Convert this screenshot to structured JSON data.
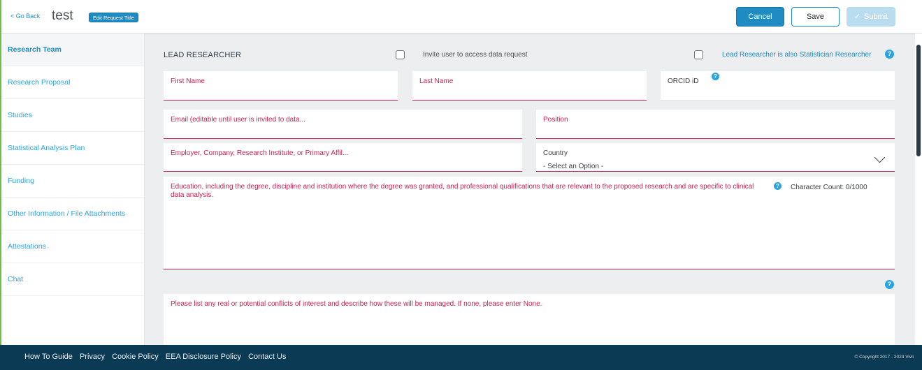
{
  "header": {
    "go_back": "< Go Back",
    "title": "test",
    "edit_title_label": "Edit Request Title",
    "cancel_label": "Cancel",
    "save_label": "Save",
    "submit_label": "Submit"
  },
  "sidebar": {
    "items": [
      {
        "label": "Research Team"
      },
      {
        "label": "Research Proposal"
      },
      {
        "label": "Studies"
      },
      {
        "label": "Statistical Analysis Plan"
      },
      {
        "label": "Funding"
      },
      {
        "label": "Other Information / File Attachments"
      },
      {
        "label": "Attestations"
      },
      {
        "label": "Chat"
      }
    ]
  },
  "main": {
    "section_title": "LEAD RESEARCHER",
    "invite_label": "Invite user to access data request",
    "statistician_label": "Lead Researcher is also Statistician Researcher",
    "help_glyph": "?",
    "fields": {
      "first_name": "First Name",
      "last_name": "Last Name",
      "orcid": "ORCID iD",
      "email": "Email (editable until user is invited to data...",
      "position": "Position",
      "employer": "Employer, Company, Research Institute, or Primary Affil...",
      "country": "Country",
      "country_value": "- Select an Option -",
      "education": "Education, including the degree, discipline and institution where the degree was granted, and professional qualifications that are relevant to the proposed research and are specific to clinical data analysis.",
      "character_count": "Character Count:  0/1000",
      "conflicts": "Please list any real or potential conflicts of interest and describe how these will be managed. If none, please enter None."
    }
  },
  "footer": {
    "links": [
      "How To Guide",
      "Privacy",
      "Cookie Policy",
      "EEA Disclosure Policy",
      "Contact Us"
    ],
    "copyright": "© Copyright 2017 - 2023 Vivli"
  },
  "colors": {
    "accent_blue": "#1e8bc3",
    "required_red": "#c8204e",
    "footer_navy": "#0b3a55"
  }
}
